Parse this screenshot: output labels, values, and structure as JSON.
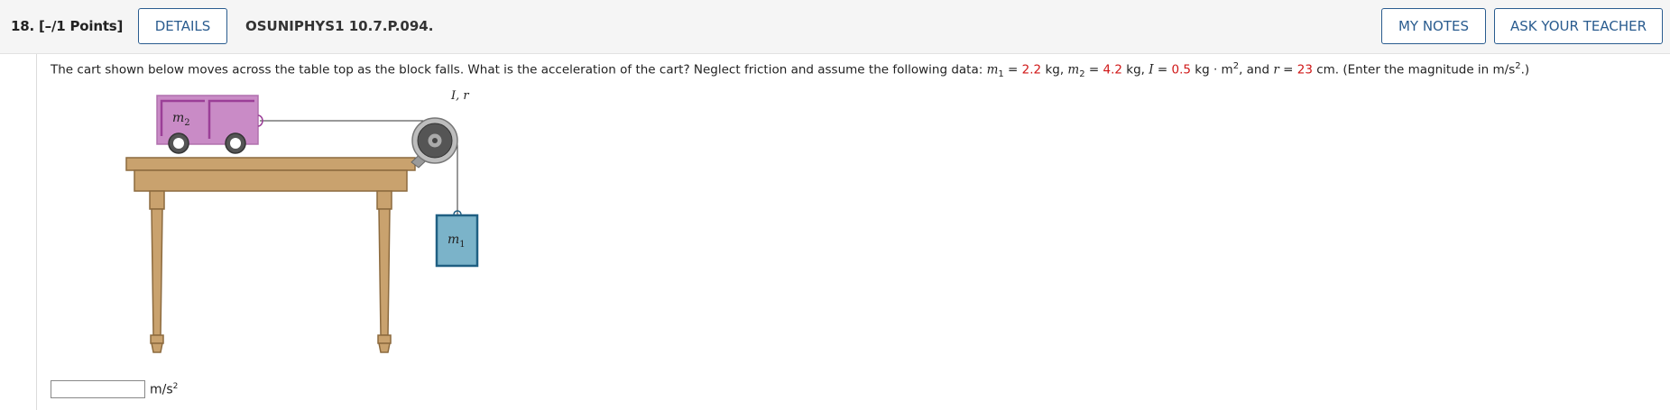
{
  "header": {
    "question_number": "18.",
    "points": "[–/1 Points]",
    "details_label": "DETAILS",
    "question_id": "OSUNIPHYS1 10.7.P.094.",
    "my_notes_label": "MY NOTES",
    "ask_teacher_label": "ASK YOUR TEACHER"
  },
  "question": {
    "intro": "The cart shown below moves across the table top as the block falls. What is the acceleration of the cart? Neglect friction and assume the following data: ",
    "m1_symbol": "m",
    "m1_sub": "1",
    "eq1": " = ",
    "m1_value": "2.2",
    "m1_unit": " kg, ",
    "m2_symbol": "m",
    "m2_sub": "2",
    "eq2": " = ",
    "m2_value": "4.2",
    "m2_unit": " kg, ",
    "I_symbol": "I",
    "eq3": " = ",
    "I_value": "0.5",
    "I_unit": " kg · m",
    "I_unit_sup": "2",
    "and_text": ", and ",
    "r_symbol": "r",
    "eq4": " = ",
    "r_value": "23",
    "r_unit": " cm. (Enter the magnitude in m/s",
    "r_unit_sup": "2",
    "tail": ".)"
  },
  "figure": {
    "cart_label": "m",
    "cart_label_sub": "2",
    "block_label": "m",
    "block_label_sub": "1",
    "pulley_label": "I, r",
    "colors": {
      "cart": "#c98bc6",
      "cart_border": "#a25aa0",
      "table": "#c9a26e",
      "table_edge": "#8c6a3e",
      "block": "#7bb3c9",
      "block_border": "#1f5f82",
      "pulley": "#555555"
    }
  },
  "answer": {
    "value": "",
    "unit": "m/s",
    "unit_sup": "2"
  }
}
